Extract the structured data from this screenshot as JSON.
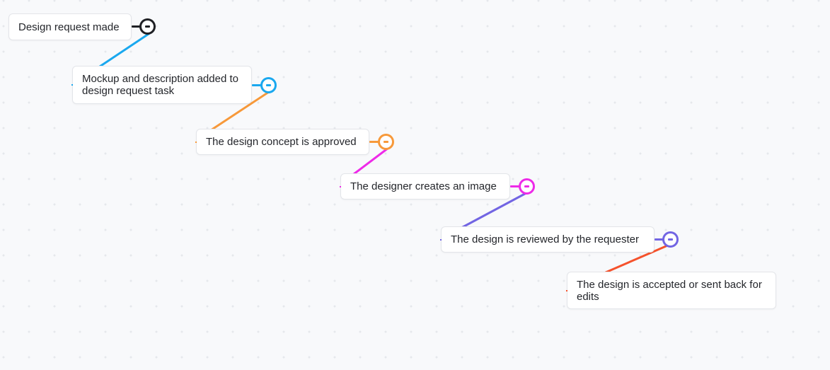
{
  "diagram": {
    "type": "mind-map",
    "nodes": [
      {
        "id": "n1",
        "label": "Design request made",
        "color": "#1f2024",
        "collapse_icon": "minus-circle-icon"
      },
      {
        "id": "n2",
        "label": "Mockup and description added to design request task",
        "color": "#1aa8ef",
        "collapse_icon": "minus-circle-icon"
      },
      {
        "id": "n3",
        "label": "The design concept is approved",
        "color": "#f7993a",
        "collapse_icon": "minus-circle-icon"
      },
      {
        "id": "n4",
        "label": "The designer creates an image",
        "color": "#ee2ae8",
        "collapse_icon": "minus-circle-icon"
      },
      {
        "id": "n5",
        "label": "The design is reviewed by the requester",
        "color": "#7265e3",
        "collapse_icon": "minus-circle-icon"
      },
      {
        "id": "n6",
        "label": "The design is accepted or sent back for edits",
        "color": "#f5522c"
      }
    ],
    "edges": [
      {
        "from": "n1",
        "to": "n2",
        "color": "#1aa8ef"
      },
      {
        "from": "n2",
        "to": "n3",
        "color": "#f7993a"
      },
      {
        "from": "n3",
        "to": "n4",
        "color": "#ee2ae8"
      },
      {
        "from": "n4",
        "to": "n5",
        "color": "#7265e3"
      },
      {
        "from": "n5",
        "to": "n6",
        "color": "#f5522c"
      }
    ]
  }
}
